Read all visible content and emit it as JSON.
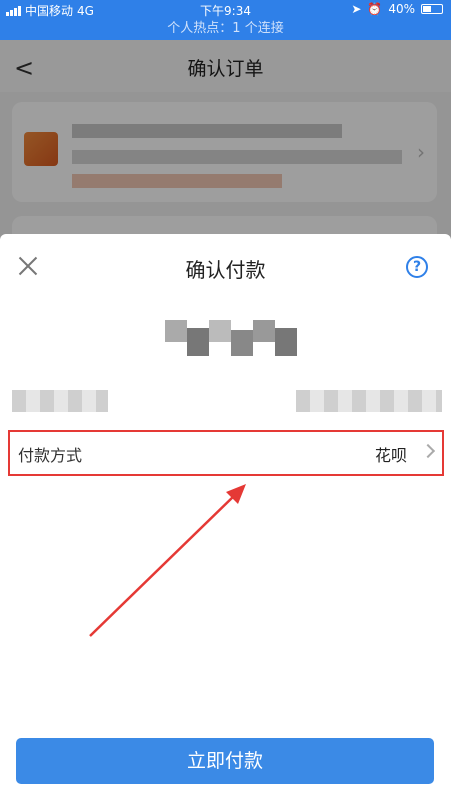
{
  "status_bar": {
    "carrier": "中国移动",
    "network": "4G",
    "time": "下午9:34",
    "battery": "40%"
  },
  "hotspot_banner": "个人热点：1 个连接",
  "nav": {
    "title": "确认订单"
  },
  "sheet": {
    "title": "确认付款",
    "payment_method_label": "付款方式",
    "payment_method_value": "花呗",
    "pay_button_label": "立即付款"
  },
  "colors": {
    "brand_blue": "#2f80e8",
    "button_blue": "#3b8ae6",
    "annotation_red": "#e53935"
  },
  "icons": {
    "close": "close-icon",
    "help": "help-icon",
    "chevron": "chevron-right-icon",
    "back": "back-icon"
  }
}
